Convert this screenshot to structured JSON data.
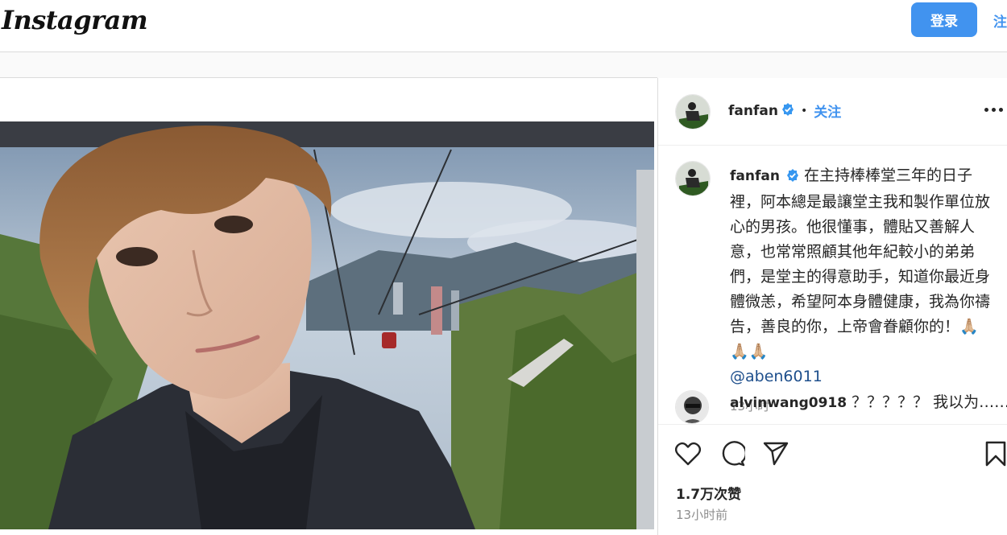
{
  "app": {
    "logo_text": "Instagram"
  },
  "topbar": {
    "login_label": "登录",
    "signup_label": "注"
  },
  "post": {
    "author": "fanfan",
    "follow_label": "关注",
    "separator": "•",
    "caption": "在主持棒棒堂三年的日子裡，阿本總是最讓堂主我和製作單位放心的男孩。他很懂事，體貼又善解人意，也常常照顧其他年紀較小的弟弟們，是堂主的得意助手，知道你最近身體微恙，希望阿本身體健康，我為你禱告，善良的你，上帝會眷顧你的！🙏🏼🙏🏼🙏🏼",
    "mention": "@aben6011",
    "caption_time": "13小时",
    "likes": "1.7万次赞",
    "posted_ago": "13小时前"
  },
  "comments": [
    {
      "user": "alvinwang0918",
      "text": "？？？？？ 我以为……畢竟本阿本以看一你真的说活"
    }
  ],
  "icons": {
    "verified": "verified-badge-icon",
    "more": "more-options-icon",
    "like": "heart-icon",
    "comment": "comment-bubble-icon",
    "share": "paper-plane-icon",
    "save": "bookmark-icon"
  },
  "colors": {
    "accent": "#4193ef",
    "mention": "#1e4f8c",
    "muted": "#8e8e8e"
  }
}
